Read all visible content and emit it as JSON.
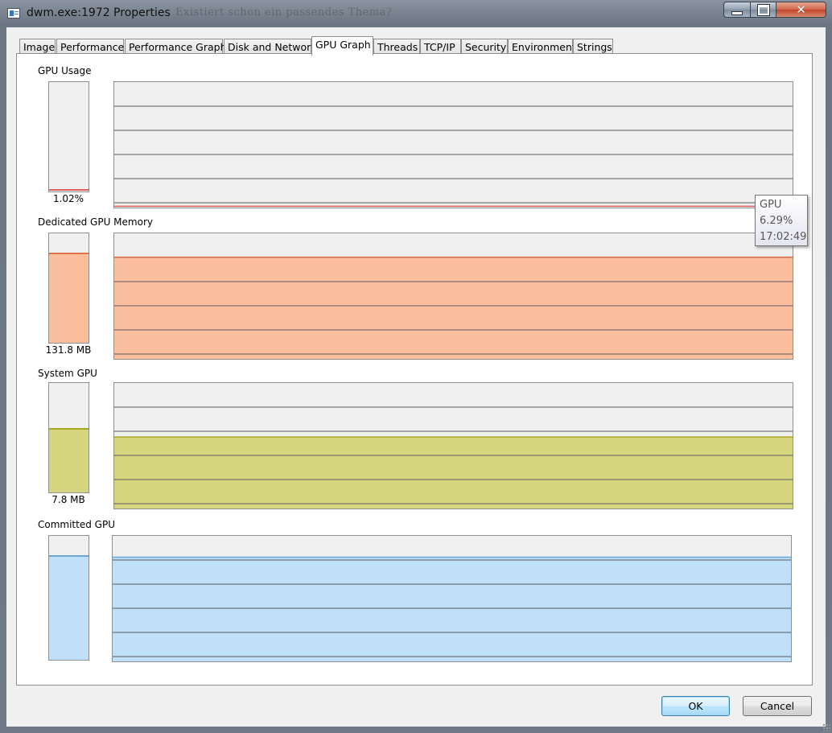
{
  "window": {
    "title": "dwm.exe:1972 Properties",
    "background_title": "Existiert schon ein passendes Thema?"
  },
  "tabs": [
    {
      "label": "Image",
      "active": false
    },
    {
      "label": "Performance",
      "active": false
    },
    {
      "label": "Performance Graph",
      "active": false
    },
    {
      "label": "Disk and Network",
      "active": false
    },
    {
      "label": "GPU Graph",
      "active": true
    },
    {
      "label": "Threads",
      "active": false
    },
    {
      "label": "TCP/IP",
      "active": false
    },
    {
      "label": "Security",
      "active": false
    },
    {
      "label": "Environment",
      "active": false
    },
    {
      "label": "Strings",
      "active": false
    }
  ],
  "sections": [
    {
      "title": "GPU Usage",
      "value_label": "1.02%",
      "level": 0.0102,
      "fill": "#f0f0f0",
      "line": "#e06060"
    },
    {
      "title": "Dedicated GPU Memory",
      "value_label": "131.8 MB",
      "level": 0.81,
      "fill": "#fdbe9e",
      "line": "#e0704a"
    },
    {
      "title": "System GPU",
      "value_label": "7.8 MB",
      "level": 0.57,
      "fill": "#d5d57f",
      "line": "#a8a820"
    },
    {
      "title": "Committed GPU",
      "value_label": "",
      "level": 0.83,
      "fill": "#c0dff9",
      "line": "#6aa7d6"
    }
  ],
  "tooltip": {
    "lines": [
      "GPU",
      "6.29%",
      "17:02:49"
    ]
  },
  "buttons": {
    "ok": "OK",
    "cancel": "Cancel"
  },
  "colors": {
    "graph_background": "#f0f0f0",
    "grid_line": "#5a5a5a",
    "close_button": "#c2422a"
  }
}
